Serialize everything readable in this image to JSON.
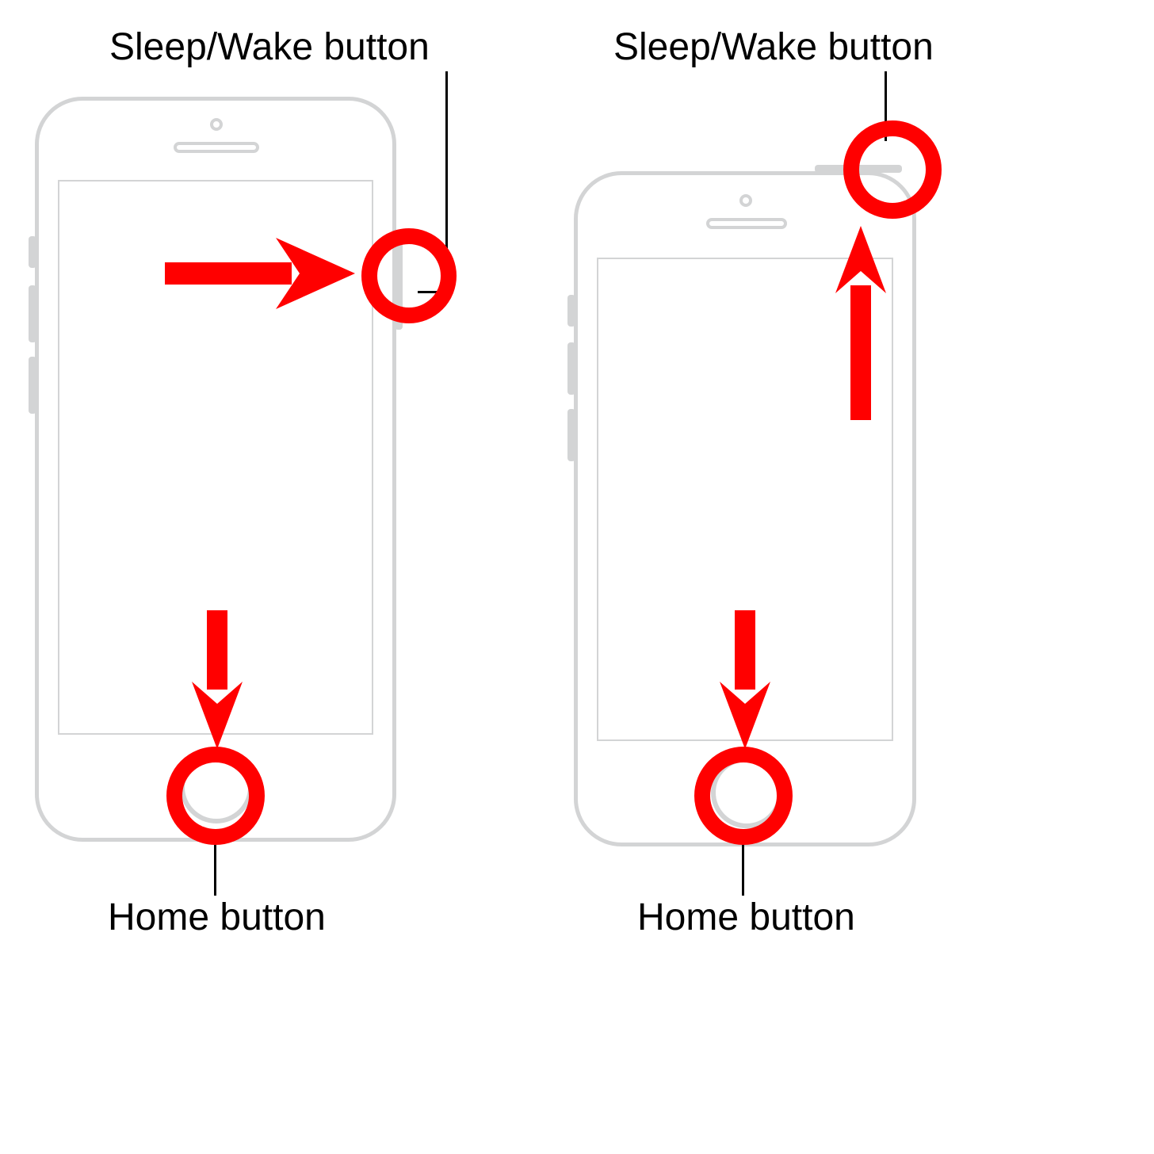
{
  "accent": "#ff0000",
  "labels": {
    "left_top": "Sleep/Wake button",
    "right_top": "Sleep/Wake button",
    "left_bot": "Home button",
    "right_bot": "Home button"
  },
  "callouts": {
    "left": {
      "sleep_wake": "side-right",
      "home": "front-bottom"
    },
    "right": {
      "sleep_wake": "top-right",
      "home": "front-bottom"
    }
  }
}
